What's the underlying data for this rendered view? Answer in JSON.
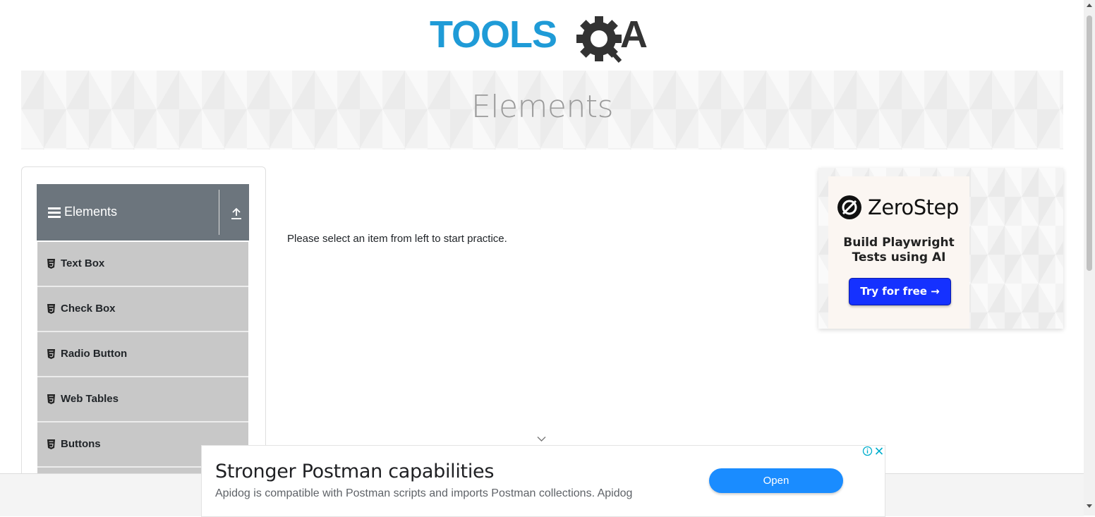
{
  "logo": {
    "text_part": "TOOLS",
    "text_part2": "A",
    "brand_blue": "#1f9bd7",
    "brand_dark": "#333333"
  },
  "banner": {
    "title": "Elements"
  },
  "sidebar": {
    "group_title": "Elements",
    "items": [
      {
        "label": "Text Box"
      },
      {
        "label": "Check Box"
      },
      {
        "label": "Radio Button"
      },
      {
        "label": "Web Tables"
      },
      {
        "label": "Buttons"
      }
    ]
  },
  "main": {
    "instruction": "Please select an item from left to start practice."
  },
  "side_ad": {
    "brand": "ZeroStep",
    "tagline_line1": "Build Playwright",
    "tagline_line2": "Tests using AI",
    "cta": "Try for free →",
    "cta_color": "#1531ff"
  },
  "bottom_ad": {
    "headline": "Stronger Postman capabilities",
    "description": "Apidog is compatible with Postman scripts and imports Postman collections. Apidog",
    "button": "Open",
    "button_color": "#1a8cff"
  },
  "colors": {
    "sidebar_header": "#6c757d",
    "menu_item_bg": "#c8c8c8"
  }
}
